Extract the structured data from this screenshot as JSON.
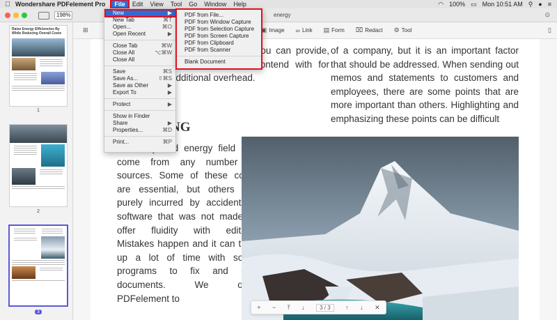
{
  "menubar": {
    "app_name": "Wondershare PDFelement Pro",
    "menus": [
      "File",
      "Edit",
      "View",
      "Tool",
      "Go",
      "Window",
      "Help"
    ],
    "status": {
      "battery": "100%",
      "time": "Mon 10:51 AM"
    }
  },
  "window": {
    "zoom": "198%",
    "tab_title": "energy"
  },
  "toolbar": {
    "items": [
      "t",
      "Image",
      "Link",
      "Form",
      "Redact",
      "Tool"
    ]
  },
  "file_menu": {
    "items": [
      {
        "label": "New",
        "shortcut": "▶"
      },
      {
        "label": "New Tab",
        "shortcut": "⌘T"
      },
      {
        "label": "Open...",
        "shortcut": "⌘O"
      },
      {
        "label": "Open Recent",
        "shortcut": "▶"
      },
      {
        "label": "Close Tab",
        "shortcut": "⌘W"
      },
      {
        "label": "Close All",
        "shortcut": "⌥⌘W"
      },
      {
        "label": "Close All",
        "shortcut": ""
      },
      {
        "label": "Save",
        "shortcut": "⌘S"
      },
      {
        "label": "Save As...",
        "shortcut": "⇧⌘S"
      },
      {
        "label": "Save as Other",
        "shortcut": "▶"
      },
      {
        "label": "Export To",
        "shortcut": "▶"
      },
      {
        "label": "Protect",
        "shortcut": "▶"
      },
      {
        "label": "Show in Finder",
        "shortcut": ""
      },
      {
        "label": "Share",
        "shortcut": "▶"
      },
      {
        "label": "Properties...",
        "shortcut": "⌘D"
      },
      {
        "label": "Print...",
        "shortcut": "⌘P"
      }
    ]
  },
  "new_submenu": {
    "items": [
      "PDF from File...",
      "PDF from Window Capture",
      "PDF from Selection Capture",
      "PDF from Screen Capture",
      "PDF from Clipboard",
      "PDF from Scanner",
      "Blank Document"
    ]
  },
  "thumbnails": {
    "page1_title": "Raise Energy Efficiencies By While Reducing Overall Costs",
    "pages": [
      "1",
      "2",
      "3"
    ]
  },
  "document": {
    "left_top": "outsource services you can provide, the less costs to contend with for additional overhead.",
    "heading": "NG",
    "left_bottom": "the utility and energy field can come from any number of sources. Some of these costs are essential, but others are purely incurred by accident or software that was not made to offer fluidity with editing. Mistakes happen and it can take up a lot of time with some programs to fix and edit documents. We offer PDFelement to",
    "right": "of a company, but it is an important factor that should be addressed. When sending out memos and statements to customers and employees, there are some points that are more important than others. Highlighting and emphasizing these points can be difficult"
  },
  "pager": {
    "current": "3",
    "total": "3",
    "zoom_in": "+",
    "zoom_out": "−",
    "close": "✕"
  }
}
